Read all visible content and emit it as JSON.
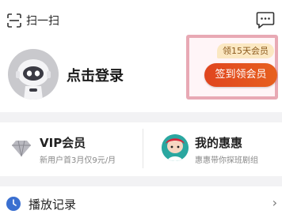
{
  "header": {
    "scan_label": "扫一扫"
  },
  "user": {
    "login_label": "点击登录"
  },
  "promo": {
    "bubble": "领15天会员",
    "button": "签到领会员"
  },
  "vip": {
    "title": "VIP会员",
    "subtitle": "新用户首3月仅9元/月"
  },
  "hui": {
    "title": "我的惠惠",
    "subtitle": "惠惠带你探班剧组"
  },
  "history": {
    "label": "播放记录"
  },
  "colors": {
    "accent": "#e0451f",
    "highlight_border": "#e8a9b4"
  }
}
